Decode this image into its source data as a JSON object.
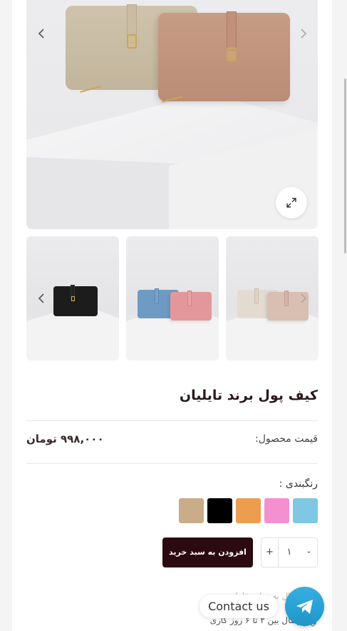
{
  "product": {
    "title": "کیف پول برند تایلیان",
    "price_label": "قیمت محصول:",
    "price_value": "۹۹۸,۰۰۰ تومان",
    "color_label": "رنگبندی :"
  },
  "gallery": {
    "prev_icon": "chevron-left-icon",
    "next_icon": "chevron-right-icon",
    "zoom_icon": "expand-icon"
  },
  "swatches": [
    {
      "name": "light-blue",
      "color": "#7ec8e3"
    },
    {
      "name": "pink",
      "color": "#f490cf"
    },
    {
      "name": "orange",
      "color": "#ee9d4f"
    },
    {
      "name": "black",
      "color": "#000000"
    },
    {
      "name": "beige",
      "color": "#c9ac88"
    }
  ],
  "cart": {
    "minus": "-",
    "quantity": "۱",
    "plus": "+",
    "add_label": "افزودن به سبد خرید"
  },
  "shipping": {
    "line1": "ارسال به تمام نقاط ...",
    "line2": "ارسال بین ۲ تا ۶ روز کاری"
  },
  "contact": {
    "label": "Contact us",
    "icon": "telegram-icon"
  },
  "colors": {
    "accent_dark": "#2c0a12",
    "telegram_blue": "#2aa3d8"
  }
}
